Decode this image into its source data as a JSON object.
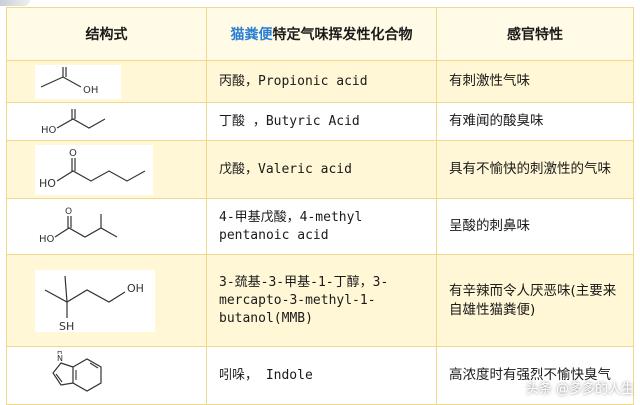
{
  "headers": {
    "structure": "结构式",
    "compound_highlight": "猫粪便",
    "compound_rest": "特定气味挥发性化合物",
    "sensory": "感官特性"
  },
  "rows": [
    {
      "name": "丙酸，Propionic acid",
      "sense": "有刺激性气味",
      "mol_icon": "propionic-acid-structure",
      "label": "OH"
    },
    {
      "name": "丁酸 ，Butyric Acid",
      "sense": "有难闻的酸臭味",
      "mol_icon": "butyric-acid-structure",
      "label": "HO"
    },
    {
      "name": "戊酸，Valeric acid",
      "sense": "具有不愉快的刺激性的气味",
      "mol_icon": "valeric-acid-structure",
      "label": "HO"
    },
    {
      "name": "4-甲基戊酸，4-methyl pentanoic acid",
      "sense": "呈酸的刺鼻味",
      "mol_icon": "4-methylpentanoic-acid-structure",
      "label": "HO"
    },
    {
      "name": "3-巯基-3-甲基-1-丁醇，3-mercapto-3-methyl-1-butanol(MMB)",
      "sense": "有辛辣而令人厌恶味(主要来自雄性猫粪便)",
      "mol_icon": "mmb-structure",
      "label_oh": "OH",
      "label_sh": "SH"
    },
    {
      "name": "吲哚， Indole",
      "sense": "高浓度时有强烈不愉快臭气",
      "mol_icon": "indole-structure",
      "label_nh": "N\nH"
    }
  ],
  "watermark": "头条 @多多的人生"
}
